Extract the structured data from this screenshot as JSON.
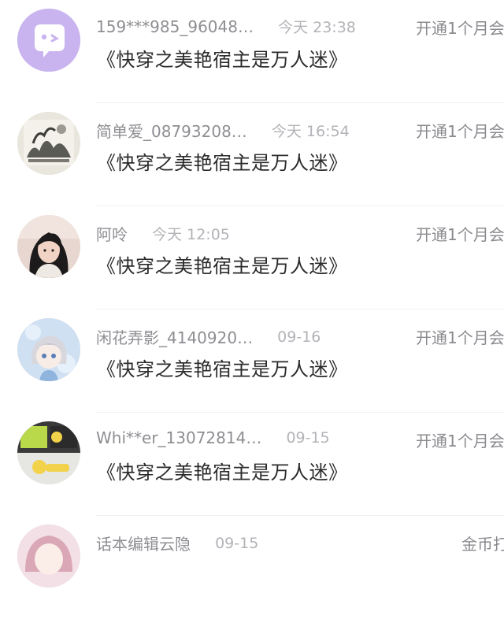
{
  "messages": [
    {
      "username": "159***985_96048…",
      "time": "今天 23:38",
      "book_title": "《快穿之美艳宿主是万人迷》",
      "action": "开通1个月会",
      "avatar_icon": "default-chat-avatar-icon",
      "avatar_color": "#c9b4f0"
    },
    {
      "username": "简单爱_08793208…",
      "time": "今天 16:54",
      "book_title": "《快穿之美艳宿主是万人迷》",
      "action": "开通1个月会",
      "avatar_icon": "landscape-painting-avatar-icon"
    },
    {
      "username": "阿呤",
      "time": "今天 12:05",
      "book_title": "《快穿之美艳宿主是万人迷》",
      "action": "开通1个月会",
      "avatar_icon": "girl-photo-avatar-icon"
    },
    {
      "username": "闲花弄影_4140920…",
      "time": "09-16",
      "book_title": "《快穿之美艳宿主是万人迷》",
      "action": "开通1个月会",
      "avatar_icon": "anime-character-avatar-icon"
    },
    {
      "username": "Whi**er_13072814…",
      "time": "09-15",
      "book_title": "《快穿之美艳宿主是万人迷》",
      "action": "开通1个月会",
      "avatar_icon": "yellow-figure-avatar-icon"
    },
    {
      "username": "话本编辑云隐",
      "time": "09-15",
      "action": "金币打",
      "avatar_icon": "anime-girl-avatar-icon"
    }
  ]
}
